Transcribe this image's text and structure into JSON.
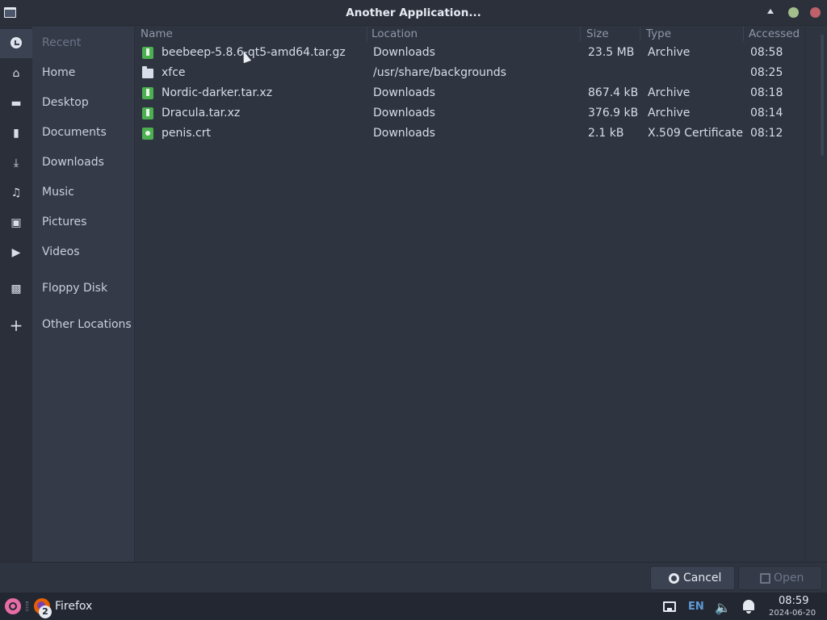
{
  "window": {
    "title": "Another Application..."
  },
  "sidebar": {
    "items": [
      {
        "label": "Recent",
        "icon": "clock-icon"
      },
      {
        "label": "Home",
        "icon": "home-icon"
      },
      {
        "label": "Desktop",
        "icon": "desktop-icon"
      },
      {
        "label": "Documents",
        "icon": "document-icon"
      },
      {
        "label": "Downloads",
        "icon": "download-icon"
      },
      {
        "label": "Music",
        "icon": "music-icon"
      },
      {
        "label": "Pictures",
        "icon": "picture-icon"
      },
      {
        "label": "Videos",
        "icon": "video-icon"
      },
      {
        "label": "Floppy Disk",
        "icon": "floppy-disk-icon"
      },
      {
        "label": "Other Locations",
        "icon": "plus-icon"
      }
    ]
  },
  "filelist": {
    "columns": [
      "Name",
      "Location",
      "Size",
      "Type",
      "Accessed"
    ],
    "rows": [
      {
        "name": "beebeep-5.8.6-qt5-amd64.tar.gz",
        "location": "Downloads",
        "size": "23.5 MB",
        "type": "Archive",
        "accessed": "08:58",
        "icon": "archive-icon"
      },
      {
        "name": "xfce",
        "location": "/usr/share/backgrounds",
        "size": "",
        "type": "",
        "accessed": "08:25",
        "icon": "folder-icon"
      },
      {
        "name": "Nordic-darker.tar.xz",
        "location": "Downloads",
        "size": "867.4 kB",
        "type": "Archive",
        "accessed": "08:18",
        "icon": "archive-icon"
      },
      {
        "name": "Dracula.tar.xz",
        "location": "Downloads",
        "size": "376.9 kB",
        "type": "Archive",
        "accessed": "08:14",
        "icon": "archive-icon"
      },
      {
        "name": "penis.crt",
        "location": "Downloads",
        "size": "2.1 kB",
        "type": "X.509 Certificate",
        "accessed": "08:12",
        "icon": "certificate-icon"
      }
    ]
  },
  "footer": {
    "cancel_label": "Cancel",
    "open_label": "Open"
  },
  "taskbar": {
    "app_label": "Firefox",
    "app_count": "2",
    "lang": "EN",
    "time": "08:59",
    "date": "2024-06-20"
  },
  "colors": {
    "accent_green": "#4caf50",
    "close": "#bf616a",
    "maximize": "#a3be8c",
    "lang_blue": "#5e9ad6"
  }
}
